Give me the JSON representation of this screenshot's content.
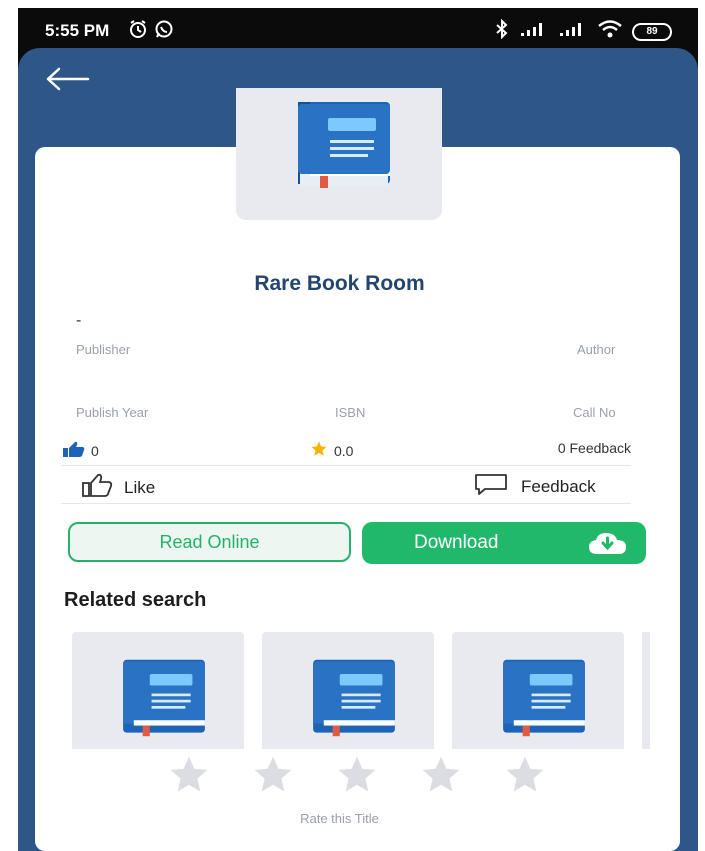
{
  "status_bar": {
    "time": "5:55 PM",
    "battery": "89",
    "left_icons": [
      "alarm-icon",
      "whatsapp-icon"
    ],
    "right_icons": [
      "bluetooth-icon",
      "signal-icon",
      "signal-icon",
      "wifi-icon",
      "battery-icon"
    ]
  },
  "header": {
    "back_icon": "back-arrow-icon"
  },
  "book": {
    "title": "Rare Book Room",
    "author_line": "-"
  },
  "details": {
    "publisher_label": "Publisher",
    "author_label": "Author",
    "publish_year_label": "Publish Year",
    "isbn_label": "ISBN",
    "call_no_label": "Call No"
  },
  "stats": {
    "likes": "0",
    "rating": "0.0",
    "feedback_count": "0 Feedback"
  },
  "actions": {
    "like_label": "Like",
    "feedback_label": "Feedback"
  },
  "buttons": {
    "read_online": "Read Online",
    "download": "Download"
  },
  "related": {
    "heading": "Related search",
    "items": 3
  },
  "rating_widget": {
    "stars": 5,
    "filled": 0,
    "label": "Rate this Title"
  },
  "colors": {
    "header_blue": "#2e5788",
    "title_blue": "#23456f",
    "green": "#22b86a",
    "star_gray": "#dcdde2",
    "star_gold": "#f4b400"
  }
}
